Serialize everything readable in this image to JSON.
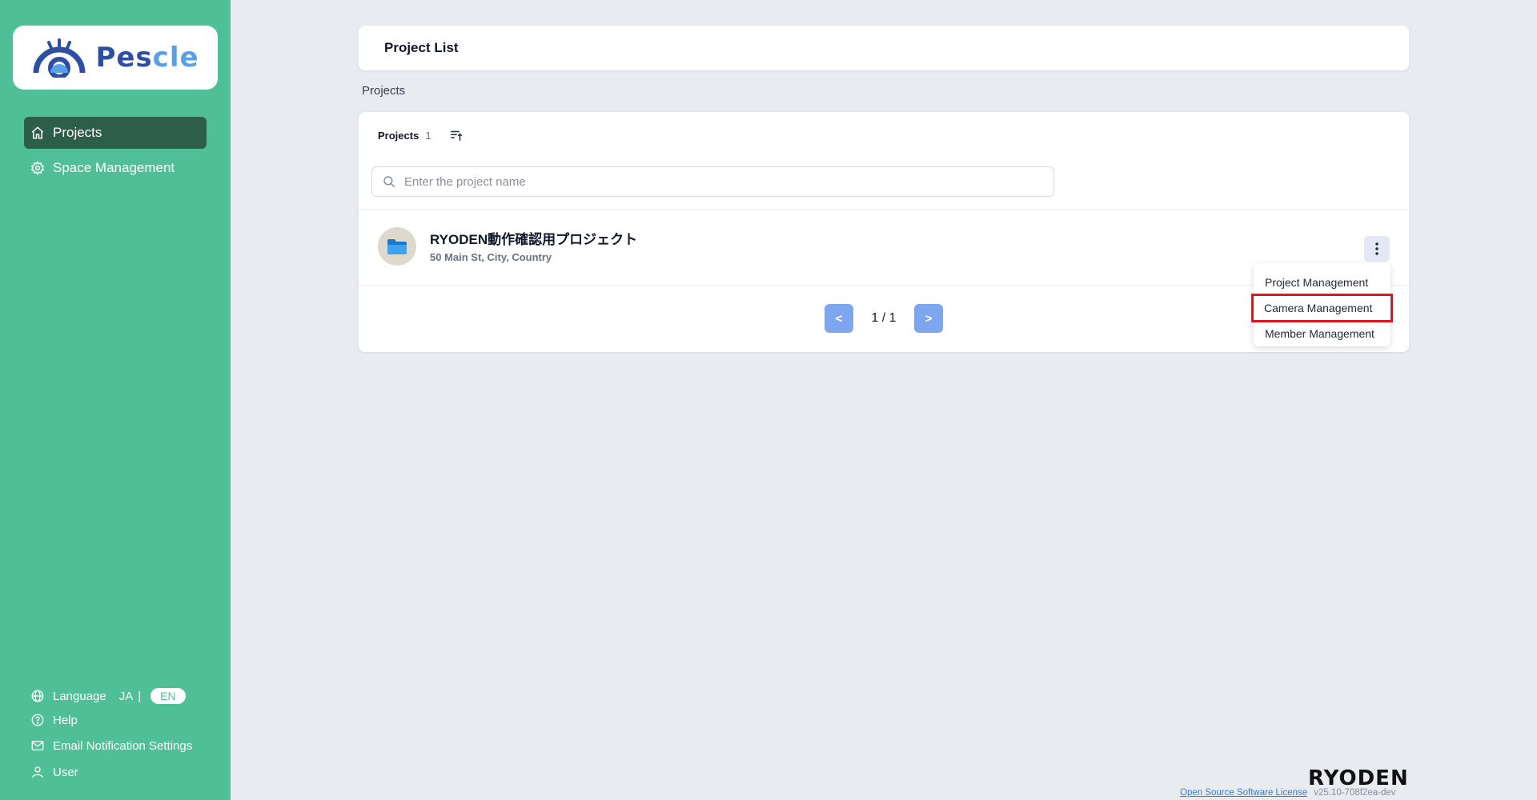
{
  "sidebar": {
    "logo_text_a": "Pes",
    "logo_text_b": "cle",
    "nav": [
      {
        "label": "Projects",
        "icon": "home-icon",
        "active": true
      },
      {
        "label": "Space Management",
        "icon": "gear-icon",
        "active": false
      }
    ],
    "bottom": {
      "language_label": "Language",
      "lang_ja": "JA",
      "lang_sep": "|",
      "lang_en": "EN",
      "help": "Help",
      "email": "Email Notification Settings",
      "user": "User"
    }
  },
  "header": {
    "title": "Project List"
  },
  "section": {
    "label": "Projects"
  },
  "list": {
    "title": "Projects",
    "count": "1",
    "search_placeholder": "Enter the project name",
    "project": {
      "name": "RYODEN動作確認用プロジェクト",
      "address": "50 Main St, City, Country"
    },
    "pager": {
      "prev": "<",
      "page": "1 / 1",
      "next": ">"
    }
  },
  "menu": {
    "items": [
      "Project Management",
      "Camera Management",
      "Member Management"
    ],
    "highlighted_index": 1,
    "highlight_color": "#e1131f"
  },
  "footer": {
    "brand": "RYODEN",
    "license": "Open Source Software License",
    "version": "v25.10-708f2ea-dev"
  },
  "colors": {
    "sidebar": "#4ebf97",
    "active_nav": "#2c5e4a",
    "pager_btn": "#7da6ee"
  }
}
